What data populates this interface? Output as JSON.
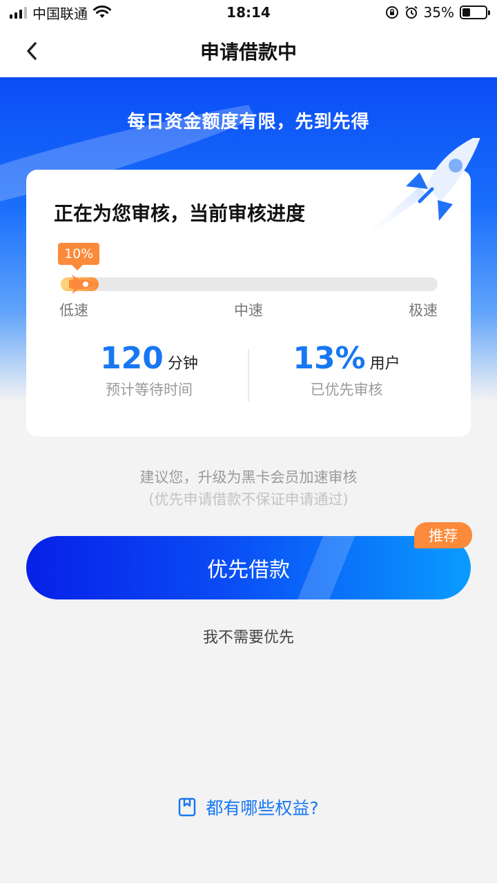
{
  "status_bar": {
    "carrier": "中国联通",
    "time": "18:14",
    "battery_percent": "35%",
    "battery_level": 0.35,
    "icons": [
      "signal-icon",
      "wifi-icon",
      "rotation-lock-icon",
      "alarm-icon",
      "battery-icon"
    ]
  },
  "nav": {
    "title": "申请借款中",
    "back_icon": "chevron-left-icon"
  },
  "hero": {
    "slogan": "每日资金额度有限，先到先得"
  },
  "card": {
    "title": "正在为您审核，当前审核进度",
    "progress_label": "10%",
    "progress_value": 0.1,
    "speed_labels": [
      "低速",
      "中速",
      "极速"
    ],
    "stats": [
      {
        "value": "120",
        "unit": "分钟",
        "label": "预计等待时间"
      },
      {
        "value": "13%",
        "unit": "用户",
        "label": "已优先审核"
      }
    ]
  },
  "suggest": {
    "line1": "建议您，升级为黑卡会员加速审核",
    "line2": "(优先申请借款不保证申请通过)"
  },
  "actions": {
    "priority_button": "优先借款",
    "badge": "推荐",
    "skip": "我不需要优先"
  },
  "footer": {
    "benefits_link": "都有哪些权益?",
    "benefits_icon": "bookmark-icon"
  },
  "colors": {
    "accent": "#1877f2",
    "orange": "#fb8a3a",
    "hero_blue": "#0a4cf5"
  }
}
